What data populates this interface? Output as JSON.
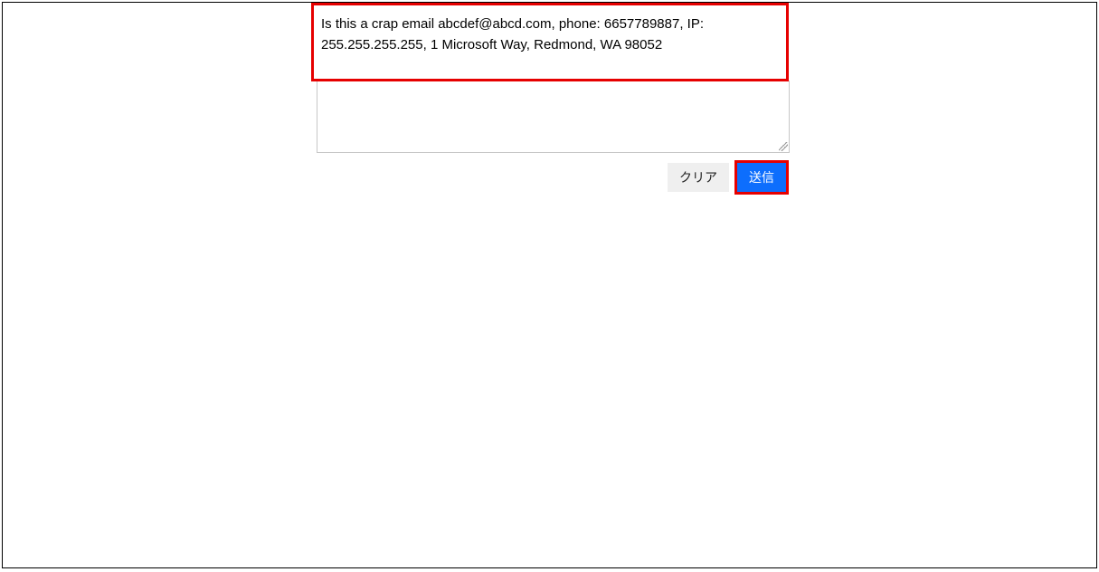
{
  "input": {
    "text": "Is this a crap email abcdef@abcd.com, phone: 6657789887, IP: 255.255.255.255, 1 Microsoft Way, Redmond, WA 98052"
  },
  "buttons": {
    "clear": "クリア",
    "submit": "送信"
  }
}
